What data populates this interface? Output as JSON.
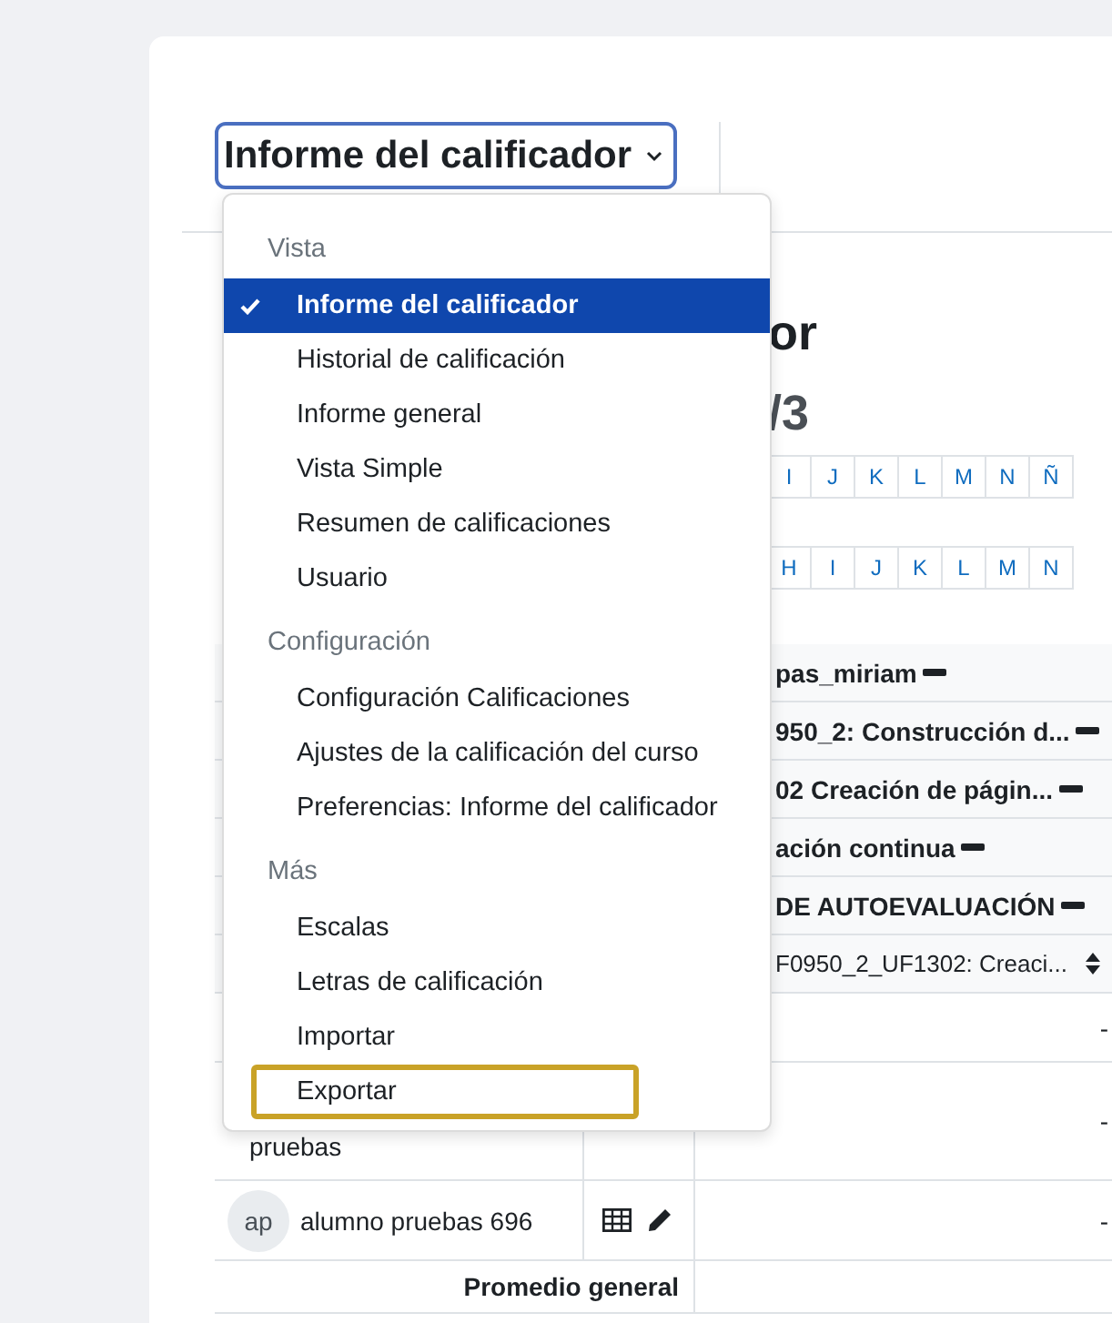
{
  "report_select": {
    "value": "Informe del calificador"
  },
  "menu": {
    "groups": [
      {
        "heading": "Vista",
        "items": [
          {
            "label": "Informe del calificador",
            "selected": true,
            "focused": false
          },
          {
            "label": "Historial de calificación",
            "selected": false,
            "focused": false
          },
          {
            "label": "Informe general",
            "selected": false,
            "focused": false
          },
          {
            "label": "Vista Simple",
            "selected": false,
            "focused": false
          },
          {
            "label": "Resumen de calificaciones",
            "selected": false,
            "focused": false
          },
          {
            "label": "Usuario",
            "selected": false,
            "focused": false
          }
        ]
      },
      {
        "heading": "Configuración",
        "items": [
          {
            "label": "Configuración Calificaciones",
            "selected": false,
            "focused": false
          },
          {
            "label": "Ajustes de la calificación del curso",
            "selected": false,
            "focused": false
          },
          {
            "label": "Preferencias: Informe del calificador",
            "selected": false,
            "focused": false
          }
        ]
      },
      {
        "heading": "Más",
        "items": [
          {
            "label": "Escalas",
            "selected": false,
            "focused": false
          },
          {
            "label": "Letras de calificación",
            "selected": false,
            "focused": false
          },
          {
            "label": "Importar",
            "selected": false,
            "focused": false
          },
          {
            "label": "Exportar",
            "selected": false,
            "focused": true
          }
        ]
      }
    ]
  },
  "page": {
    "title": "or",
    "subtitle": "/3",
    "letter_filters": [
      {
        "letters": [
          "I",
          "J",
          "K",
          "L",
          "M",
          "N",
          "Ñ"
        ]
      },
      {
        "letters": [
          "H",
          "I",
          "J",
          "K",
          "L",
          "M",
          "N"
        ]
      }
    ],
    "table": {
      "header_rows": [
        {
          "kind": "category",
          "label": "pas_miriam"
        },
        {
          "kind": "category",
          "label": "950_2: Construcción d..."
        },
        {
          "kind": "category",
          "label": "02 Creación de págin..."
        },
        {
          "kind": "category",
          "label": "ación continua"
        },
        {
          "kind": "category",
          "label": "DE AUTOEVALUACIÓN"
        },
        {
          "kind": "item",
          "label": "F0950_2_UF1302: Creaci..."
        }
      ],
      "rows": [
        {
          "kind": "blank",
          "grade": "-"
        },
        {
          "kind": "student",
          "name": "pruebas",
          "grade": "-"
        },
        {
          "kind": "student",
          "initials": "ap",
          "name": "alumno pruebas 696",
          "grade": "-"
        }
      ],
      "footer": "Promedio general"
    }
  }
}
